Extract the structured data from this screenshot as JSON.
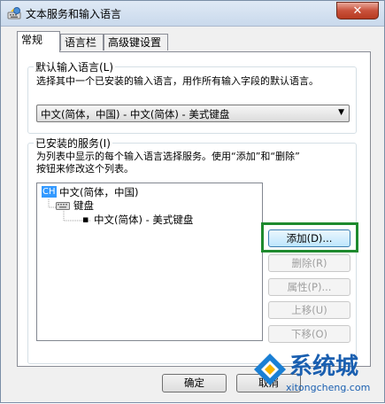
{
  "window": {
    "title": "文本服务和输入语言",
    "close_label": "✕"
  },
  "tabs": [
    {
      "label": "常规",
      "active": true
    },
    {
      "label": "语言栏",
      "active": false
    },
    {
      "label": "高级键设置",
      "active": false
    }
  ],
  "default_input": {
    "group_label": "默认输入语言(L)",
    "description": "选择其中一个已安装的输入语言，用作所有输入字段的默认语言。",
    "selected": "中文(简体，中国) - 中文(简体) - 美式键盘"
  },
  "installed_services": {
    "group_label": "已安装的服务(I)",
    "description_line1": "为列表中显示的每个输入语言选择服务。使用“添加”和“删除”",
    "description_line2": "按钮来修改这个列表。",
    "tree": {
      "language_badge": "CH",
      "language": "中文(简体，中国)",
      "category": "键盘",
      "service": "中文(简体) - 美式键盘"
    },
    "buttons": {
      "add": "添加(D)...",
      "remove": "删除(R)",
      "properties": "属性(P)...",
      "move_up": "上移(U)",
      "move_down": "下移(O)"
    }
  },
  "footer": {
    "ok": "确定",
    "cancel": "取消"
  },
  "watermark": {
    "brand": "系统城",
    "url": "xitongcheng.com"
  },
  "colors": {
    "highlight_box": "#1e8a2e",
    "selection": "#3399ff",
    "disabled_text": "#a0a0a0"
  }
}
